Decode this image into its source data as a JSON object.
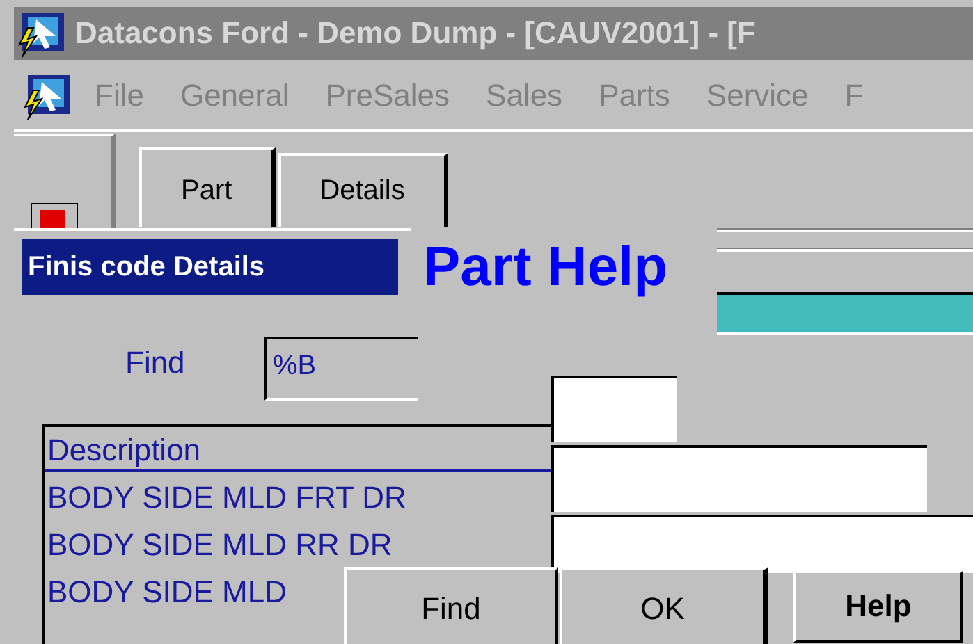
{
  "window": {
    "title": "Datacons Ford - Demo Dump - [CAUV2001] - [F"
  },
  "menu": [
    {
      "label": "File"
    },
    {
      "label": "General"
    },
    {
      "label": "PreSales"
    },
    {
      "label": "Sales"
    },
    {
      "label": "Parts"
    },
    {
      "label": "Service"
    },
    {
      "label": "F"
    }
  ],
  "tabs": [
    {
      "label": "Part",
      "selected": true
    },
    {
      "label": "Details",
      "selected": false
    }
  ],
  "part_help": {
    "title": "Part Help"
  },
  "dialog": {
    "title": "Finis code Details",
    "find_label": "Find",
    "find_value": "%B",
    "list": {
      "column": "Description",
      "rows": [
        "BODY SIDE MLD FRT DR",
        "BODY SIDE MLD RR DR",
        "BODY SIDE MLD"
      ]
    }
  },
  "buttons": [
    {
      "label": "Find",
      "bold": false
    },
    {
      "label": "OK",
      "bold": false
    },
    {
      "label": "Help",
      "bold": true
    }
  ]
}
